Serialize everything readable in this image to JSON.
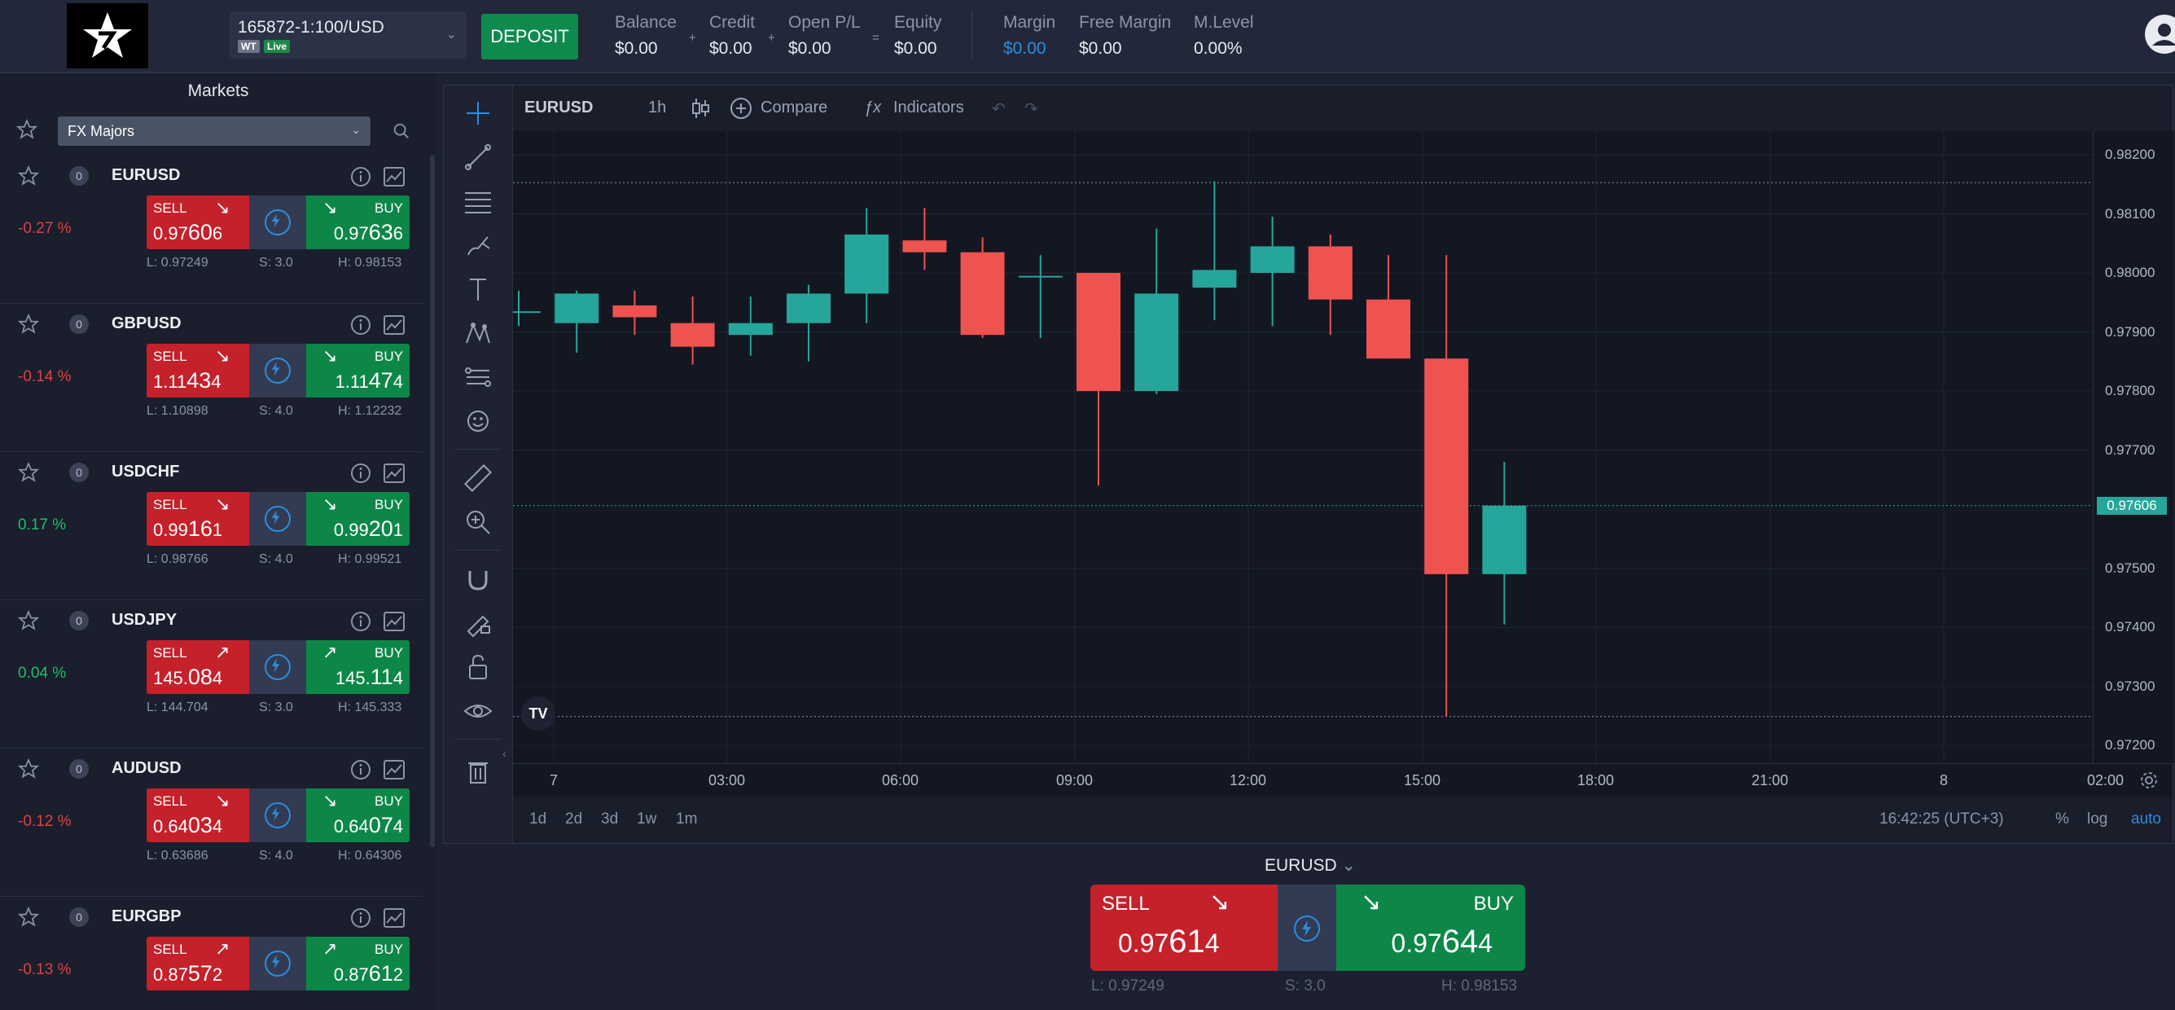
{
  "account": {
    "id": "165872-1:100/USD",
    "tag": "WT",
    "status": "Live"
  },
  "deposit_label": "DEPOSIT",
  "stats": [
    {
      "label": "Balance",
      "value": "$0.00"
    },
    {
      "label": "Credit",
      "value": "$0.00"
    },
    {
      "label": "Open P/L",
      "value": "$0.00"
    },
    {
      "label": "Equity",
      "value": "$0.00"
    },
    {
      "label": "Margin",
      "value": "$0.00"
    },
    {
      "label": "Free Margin",
      "value": "$0.00"
    },
    {
      "label": "M.Level",
      "value": "0.00%"
    }
  ],
  "operators": [
    "+",
    "+",
    "="
  ],
  "markets": {
    "title": "Markets",
    "group": "FX Majors",
    "items": [
      {
        "symbol": "EURUSD",
        "count": "0",
        "change": "-0.27 %",
        "dir": "neg",
        "sell_label": "SELL",
        "sell_pre": "0.97",
        "sell_big": "60",
        "sell_post": "6",
        "buy_label": "BUY",
        "buy_pre": "0.97",
        "buy_big": "63",
        "buy_post": "6",
        "sell_arrow": "↘",
        "buy_arrow": "↘",
        "low": "L: 0.97249",
        "spread": "S: 3.0",
        "high": "H: 0.98153"
      },
      {
        "symbol": "GBPUSD",
        "count": "0",
        "change": "-0.14 %",
        "dir": "neg",
        "sell_label": "SELL",
        "sell_pre": "1.11",
        "sell_big": "43",
        "sell_post": "4",
        "buy_label": "BUY",
        "buy_pre": "1.11",
        "buy_big": "47",
        "buy_post": "4",
        "sell_arrow": "↘",
        "buy_arrow": "↘",
        "low": "L: 1.10898",
        "spread": "S: 4.0",
        "high": "H: 1.12232"
      },
      {
        "symbol": "USDCHF",
        "count": "0",
        "change": "0.17 %",
        "dir": "pos",
        "sell_label": "SELL",
        "sell_pre": "0.99",
        "sell_big": "16",
        "sell_post": "1",
        "buy_label": "BUY",
        "buy_pre": "0.99",
        "buy_big": "20",
        "buy_post": "1",
        "sell_arrow": "↘",
        "buy_arrow": "↘",
        "low": "L: 0.98766",
        "spread": "S: 4.0",
        "high": "H: 0.99521"
      },
      {
        "symbol": "USDJPY",
        "count": "0",
        "change": "0.04 %",
        "dir": "pos",
        "sell_label": "SELL",
        "sell_pre": "145.",
        "sell_big": "08",
        "sell_post": "4",
        "buy_label": "BUY",
        "buy_pre": "145.",
        "buy_big": "11",
        "buy_post": "4",
        "sell_arrow": "↗",
        "buy_arrow": "↗",
        "low": "L: 144.704",
        "spread": "S: 3.0",
        "high": "H: 145.333"
      },
      {
        "symbol": "AUDUSD",
        "count": "0",
        "change": "-0.12 %",
        "dir": "neg",
        "sell_label": "SELL",
        "sell_pre": "0.64",
        "sell_big": "03",
        "sell_post": "4",
        "buy_label": "BUY",
        "buy_pre": "0.64",
        "buy_big": "07",
        "buy_post": "4",
        "sell_arrow": "↘",
        "buy_arrow": "↘",
        "low": "L: 0.63686",
        "spread": "S: 4.0",
        "high": "H: 0.64306"
      },
      {
        "symbol": "EURGBP",
        "count": "0",
        "change": "-0.13 %",
        "dir": "neg",
        "sell_label": "SELL",
        "sell_pre": "0.87",
        "sell_big": "57",
        "sell_post": "2",
        "buy_label": "BUY",
        "buy_pre": "0.87",
        "buy_big": "61",
        "buy_post": "2",
        "sell_arrow": "↗",
        "buy_arrow": "↗",
        "low": "",
        "spread": "",
        "high": ""
      }
    ]
  },
  "chart": {
    "symbol": "EURUSD",
    "interval": "1h",
    "compare_label": "Compare",
    "indicators_label": "Indicators",
    "price_ticks": [
      "0.98200",
      "0.98100",
      "0.98000",
      "0.97900",
      "0.97800",
      "0.97700",
      "0.97500",
      "0.97400",
      "0.97300",
      "0.97200"
    ],
    "current_price": "0.97606",
    "time_ticks": [
      "7",
      "03:00",
      "06:00",
      "09:00",
      "12:00",
      "15:00",
      "18:00",
      "21:00",
      "8",
      "02:00"
    ],
    "ranges": [
      "1d",
      "2d",
      "3d",
      "1w",
      "1m"
    ],
    "clock": "16:42:25 (UTC+3)",
    "percent_label": "%",
    "log_label": "log",
    "auto_label": "auto",
    "tv_logo": "TV"
  },
  "chart_data": {
    "type": "candlestick",
    "title": "EURUSD",
    "interval": "1h",
    "x": [
      "00:00",
      "01:00",
      "02:00",
      "03:00",
      "04:00",
      "05:00",
      "06:00",
      "07:00",
      "08:00",
      "09:00",
      "10:00",
      "11:00",
      "12:00",
      "13:00",
      "14:00",
      "15:00",
      "16:00"
    ],
    "open": [
      0.97935,
      0.97915,
      0.97945,
      0.97915,
      0.97895,
      0.97915,
      0.97965,
      0.98055,
      0.98035,
      0.97995,
      0.98,
      0.978,
      0.97975,
      0.98,
      0.98045,
      0.97955,
      0.97855,
      0.9749
    ],
    "close": [
      0.97935,
      0.97965,
      0.97925,
      0.97875,
      0.97915,
      0.97965,
      0.98065,
      0.98035,
      0.97895,
      0.97995,
      0.978,
      0.97965,
      0.98005,
      0.98045,
      0.97955,
      0.97855,
      0.9749,
      0.97606
    ],
    "high": [
      0.9797,
      0.9797,
      0.9797,
      0.9796,
      0.9796,
      0.9798,
      0.9811,
      0.9811,
      0.9806,
      0.9803,
      0.98,
      0.98075,
      0.98155,
      0.98095,
      0.98065,
      0.9803,
      0.9803,
      0.9768
    ],
    "low": [
      0.9791,
      0.97865,
      0.97895,
      0.97845,
      0.9786,
      0.9785,
      0.97915,
      0.98005,
      0.9789,
      0.9789,
      0.9764,
      0.97795,
      0.9792,
      0.9791,
      0.97895,
      0.97855,
      0.9725,
      0.97405
    ],
    "ylim": [
      0.9717,
      0.9824
    ],
    "current": 0.97606,
    "reference_lines": [
      0.98153,
      0.97249
    ]
  },
  "bottom_trade": {
    "symbol": "EURUSD",
    "chevron": "⌄",
    "sell_label": "SELL",
    "sell_pre": "0.97",
    "sell_big": "61",
    "sell_post": "4",
    "sell_arrow": "↘",
    "buy_label": "BUY",
    "buy_pre": "0.97",
    "buy_big": "64",
    "buy_post": "4",
    "buy_arrow": "↘",
    "low": "L: 0.97249",
    "spread": "S: 3.0",
    "high": "H: 0.98153"
  },
  "colors": {
    "up": "#26a69a",
    "down": "#ef5350",
    "sell": "#c4212b",
    "buy": "#0d8748",
    "accent": "#2b8de0"
  }
}
